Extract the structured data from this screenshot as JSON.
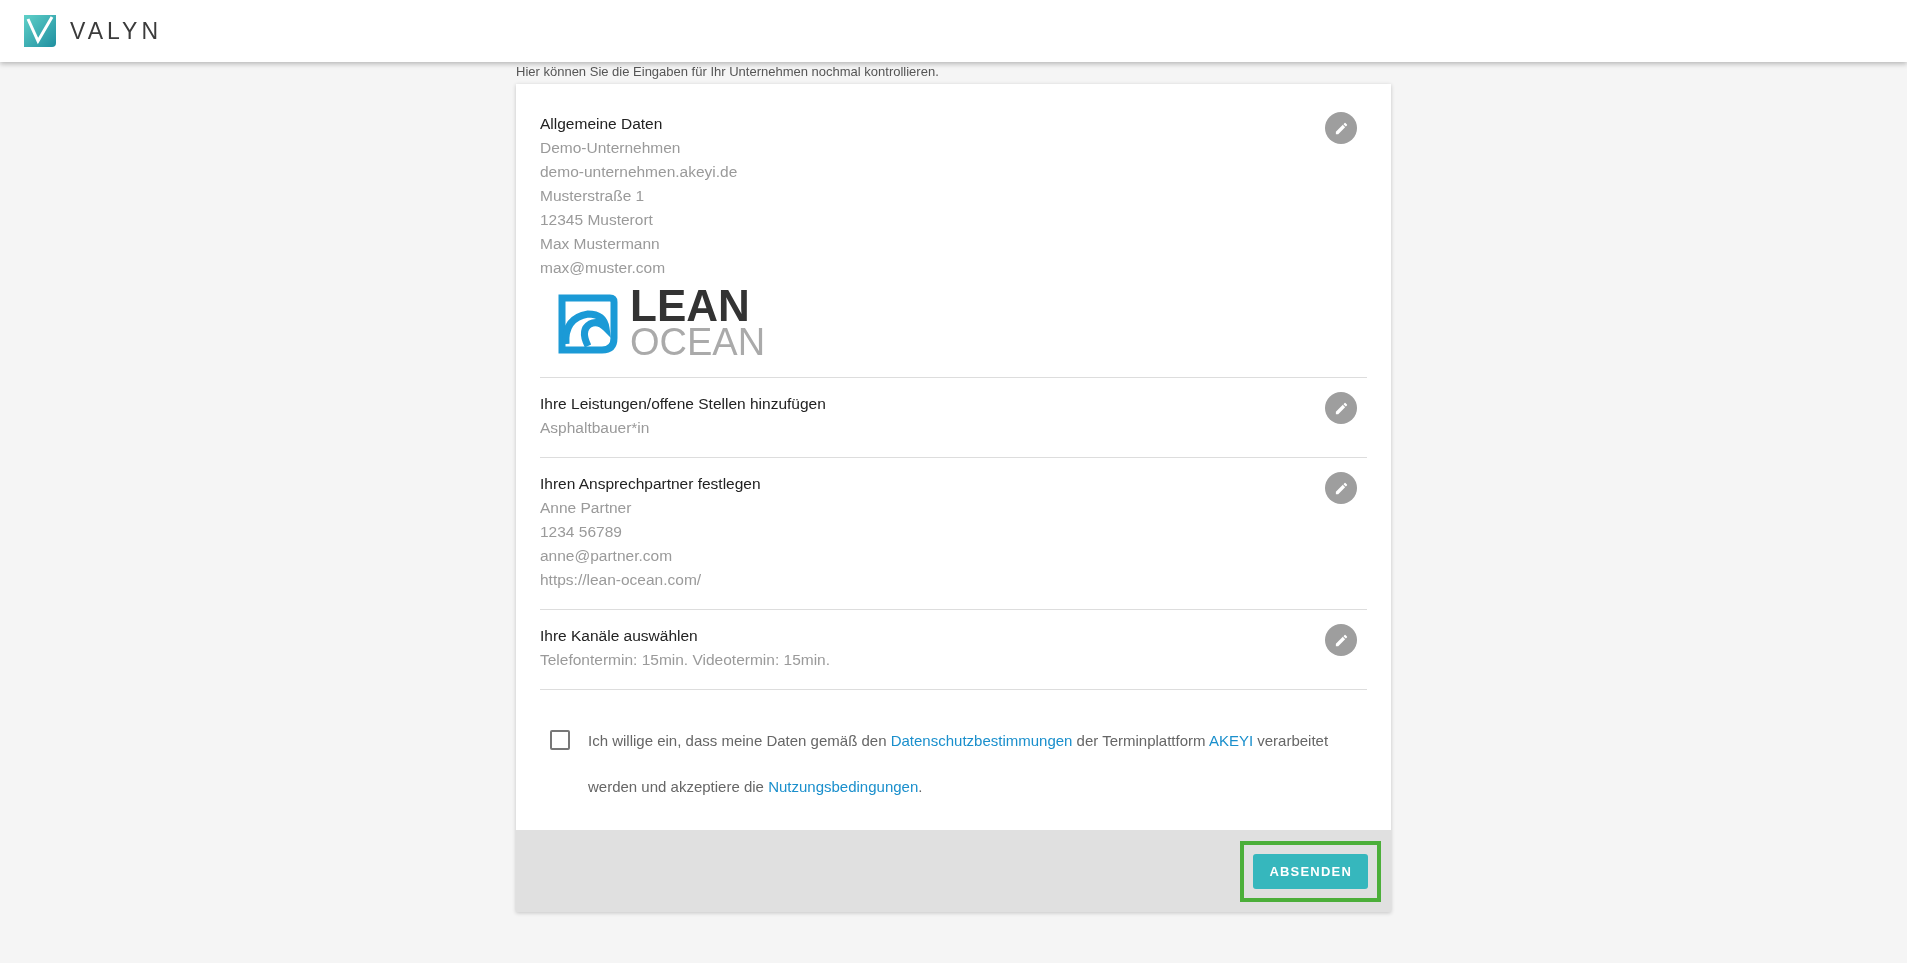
{
  "header": {
    "brand": "VALYN"
  },
  "intro": "Hier können Sie die Eingaben für Ihr Unternehmen nochmal kontrollieren.",
  "sections": [
    {
      "title": "Allgemeine Daten",
      "lines": [
        "Demo-Unternehmen",
        "demo-unternehmen.akeyi.de",
        "Musterstraße 1",
        "12345 Musterort",
        "Max Mustermann",
        "max@muster.com"
      ],
      "logo": {
        "line_1": "LEAN",
        "line_2": "OCEAN"
      }
    },
    {
      "title": "Ihre Leistungen/offene Stellen hinzufügen",
      "lines": [
        "Asphaltbauer*in"
      ]
    },
    {
      "title": "Ihren Ansprechpartner festlegen",
      "lines": [
        "Anne Partner",
        "1234 56789",
        "anne@partner.com",
        "https://lean-ocean.com/"
      ]
    },
    {
      "title": "Ihre Kanäle auswählen",
      "lines": [
        "Telefontermin: 15min. Videotermin: 15min."
      ]
    }
  ],
  "consent": {
    "checked": false,
    "parts": [
      {
        "kind": "text",
        "text": "Ich willige ein, dass meine Daten gemäß den "
      },
      {
        "kind": "link",
        "text": "Datenschutzbestimmungen"
      },
      {
        "kind": "text",
        "text": " der Terminplattform "
      },
      {
        "kind": "link",
        "text": "AKEYI"
      },
      {
        "kind": "text",
        "text": " verarbeitet werden und akzeptiere die "
      },
      {
        "kind": "link",
        "text": "Nutzungsbedingungen"
      },
      {
        "kind": "text",
        "text": "."
      }
    ]
  },
  "submit": {
    "label": "ABSENDEN",
    "highlighted": true
  }
}
